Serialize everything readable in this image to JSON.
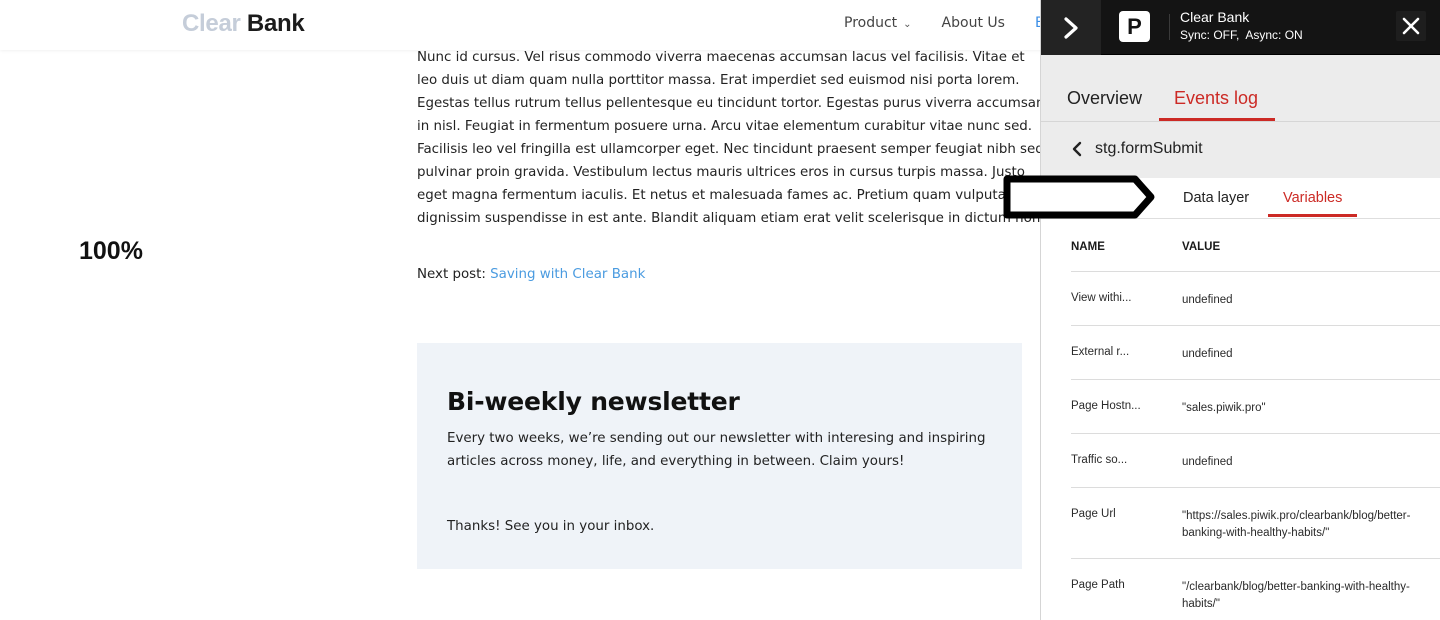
{
  "site": {
    "logo_part1": "Clear",
    "logo_part2": "Bank",
    "nav": [
      {
        "label": "Product",
        "has_dropdown": true
      },
      {
        "label": "About Us",
        "has_dropdown": false
      },
      {
        "label": "B",
        "has_dropdown": false
      }
    ]
  },
  "zoom_level": "100%",
  "article": {
    "lines": [
      "Nunc id cursus. Vel risus commodo viverra maecenas accumsan lacus vel facilisis. Vitae et",
      "leo duis ut diam quam nulla porttitor massa. Erat imperdiet sed euismod nisi porta lorem.",
      "Egestas tellus rutrum tellus pellentesque eu tincidunt tortor. Egestas purus viverra accumsan",
      "in nisl. Feugiat in fermentum posuere urna. Arcu vitae elementum curabitur vitae nunc sed.",
      "Facilisis leo vel fringilla est ullamcorper eget. Nec tincidunt praesent semper feugiat nibh sed",
      "pulvinar proin gravida. Vestibulum lectus mauris ultrices eros in cursus turpis massa. Justo",
      "eget magna fermentum iaculis. Et netus et malesuada fames ac. Pretium quam vulputate",
      "dignissim suspendisse in est ante. Blandit aliquam etiam erat velit scelerisque in dictum non."
    ],
    "next_post_label": "Next post:",
    "next_post_link": "Saving with Clear Bank"
  },
  "newsletter": {
    "title": "Bi-weekly newsletter",
    "description": "Every two weeks, we’re sending out our newsletter with interesing and inspiring articles across money, life, and everything in between. Claim yours!",
    "thanks": "Thanks! See you in your inbox."
  },
  "debugger": {
    "site_name": "Clear Bank",
    "sync_status": "Sync: OFF,  Async: ON",
    "logo_letter": "P",
    "tabs": [
      {
        "label": "Overview",
        "active": false
      },
      {
        "label": "Events log",
        "active": true
      }
    ],
    "event_name": "stg.formSubmit",
    "sub_tabs": [
      {
        "label": "Data layer",
        "active": false
      },
      {
        "label": "Variables",
        "active": true
      }
    ],
    "table": {
      "headers": [
        "NAME",
        "VALUE"
      ],
      "rows": [
        {
          "name": "View withi...",
          "value": "undefined"
        },
        {
          "name": "External r...",
          "value": "undefined"
        },
        {
          "name": "Page Hostn...",
          "value": "\"sales.piwik.pro\""
        },
        {
          "name": "Traffic so...",
          "value": "undefined"
        },
        {
          "name": "Page Url",
          "value": "\"https://sales.piwik.pro/clearbank/blog/better-banking-with-healthy-habits/\""
        },
        {
          "name": "Page Path",
          "value": "\"/clearbank/blog/better-banking-with-healthy-habits/\""
        }
      ]
    },
    "accent_color": "#cc2a25"
  }
}
